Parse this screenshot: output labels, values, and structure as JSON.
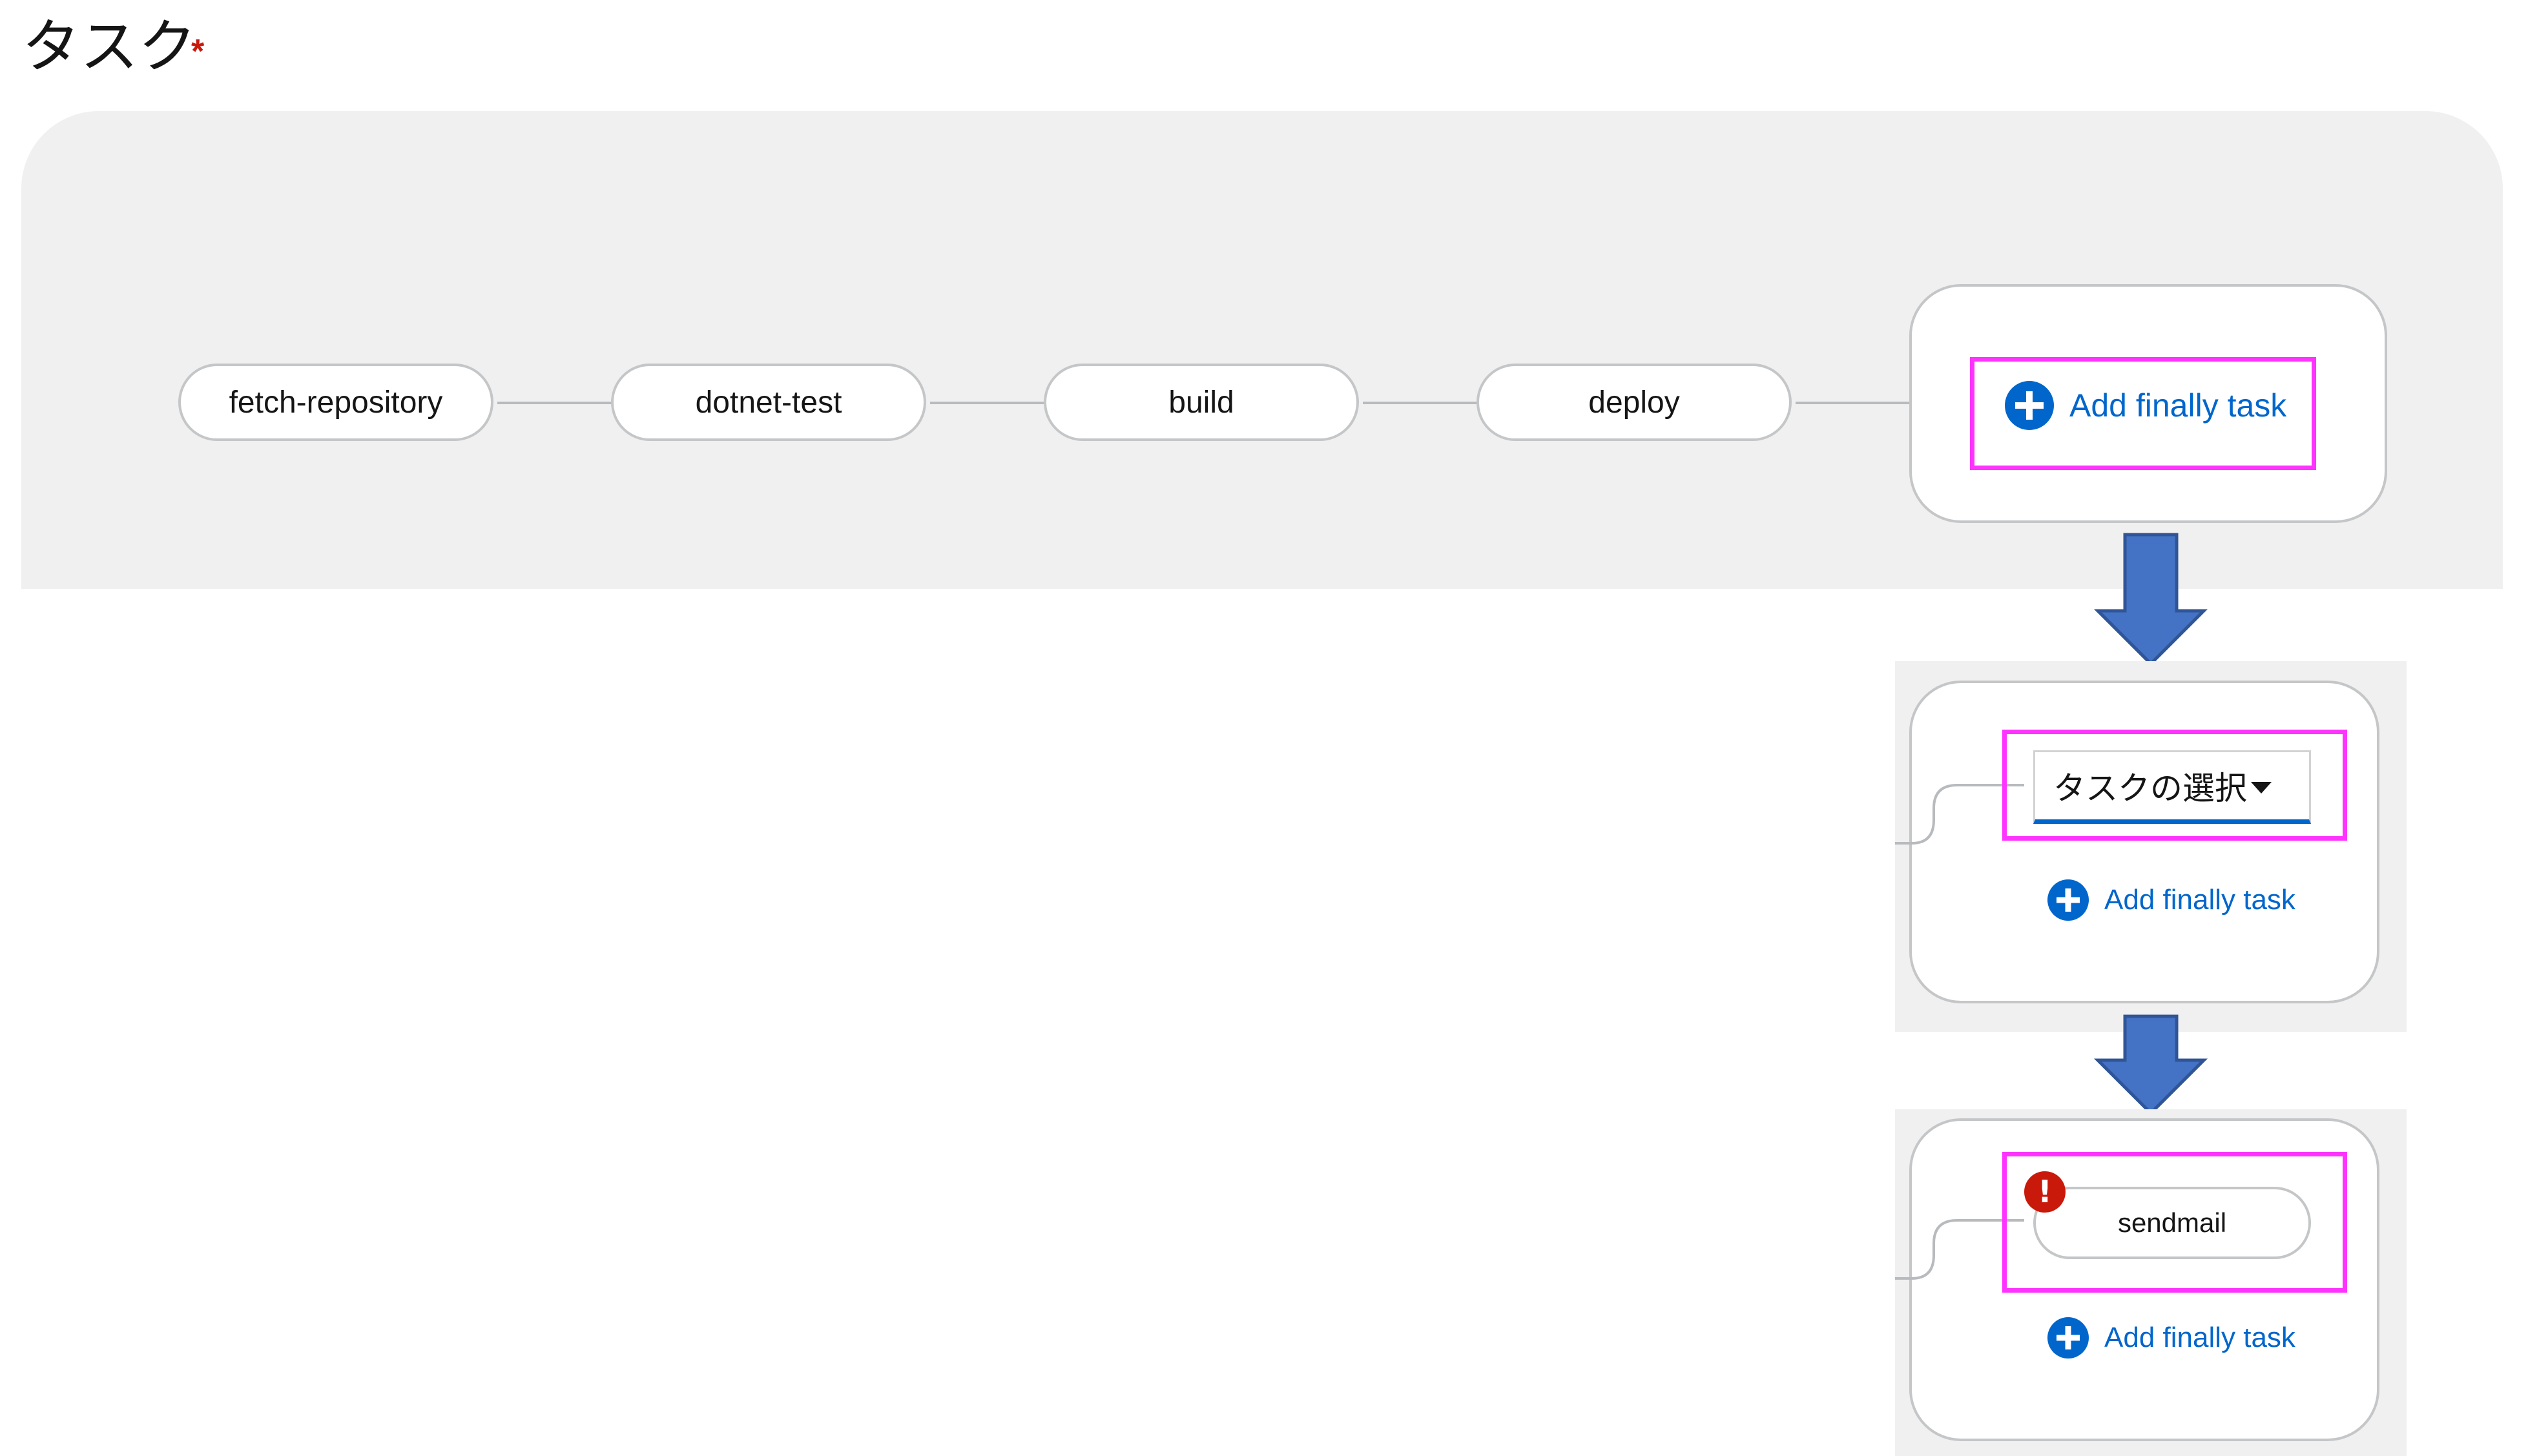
{
  "section": {
    "title": "タスク",
    "required_mark": "*"
  },
  "pipeline": {
    "tasks": [
      "fetch-repository",
      "dotnet-test",
      "build",
      "deploy"
    ],
    "add_finally_label": "Add finally task"
  },
  "step2": {
    "select_label": "タスクの選択",
    "add_finally_label": "Add finally task"
  },
  "step3": {
    "task_name": "sendmail",
    "error_symbol": "!",
    "add_finally_label": "Add finally task"
  },
  "colors": {
    "highlight": "#ff33ff",
    "link_blue": "#0066cc",
    "arrow_blue": "#4472c4",
    "error_red": "#c9190b",
    "panel_gray": "#f0f0f0"
  }
}
